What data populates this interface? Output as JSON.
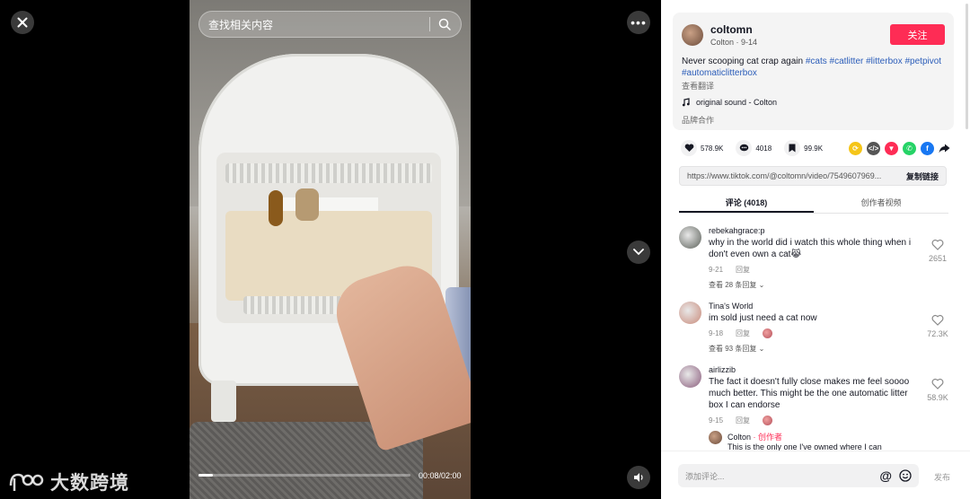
{
  "search": {
    "placeholder": "查找相关内容"
  },
  "player": {
    "progress_fraction": 0.066,
    "time_current": "00:08",
    "time_total": "02:00",
    "timecode": "00:08/02:00"
  },
  "watermark": {
    "text": "大数跨境"
  },
  "icons": {
    "close": "close-icon",
    "more": "more-icon",
    "down": "chevron-down-icon",
    "volume": "volume-icon",
    "search": "search-icon"
  },
  "author": {
    "username": "coltomn",
    "sub": "Colton · 9-14",
    "follow_label": "关注"
  },
  "caption": {
    "text": "Never scooping cat crap again ",
    "tags": [
      "#cats",
      "#catlitter",
      "#litterbox",
      "#petpivot",
      "#automaticlitterbox"
    ],
    "translate_label": "查看翻译"
  },
  "sound": {
    "label": "original sound - Colton"
  },
  "brand_label": "品牌合作",
  "stats": {
    "likes": "578.9K",
    "comments": "4018",
    "saves": "99.9K"
  },
  "share_colors": {
    "repost": "#f5c518",
    "embed": "#555555",
    "friends": "#fe2c55",
    "whatsapp": "#25d366",
    "facebook": "#1877f2"
  },
  "link": {
    "url": "https://www.tiktok.com/@coltomn/video/7549607969...",
    "copy_label": "复制链接"
  },
  "tabs": [
    {
      "label": "评论 (4018)",
      "active": true
    },
    {
      "label": "创作者视频",
      "active": false
    }
  ],
  "comments": [
    {
      "user": "rebekahgrace:p",
      "text": "why in the world did i watch this whole thing when i don't even own a cat😹",
      "date": "9-21",
      "reply_label": "回复",
      "likes": "2651",
      "replies_label": "查看 28 条回复",
      "avatar_color": "#5a5f58",
      "liked_by_author": false
    },
    {
      "user": "Tina's World",
      "text": "im sold just need a cat now",
      "date": "9-18",
      "reply_label": "回复",
      "likes": "72.3K",
      "replies_label": "查看 93 条回复",
      "avatar_color": "#c98a7a",
      "liked_by_author": true
    },
    {
      "user": "airlizzib",
      "text": "The fact it doesn't fully close makes me feel soooo much better. This might be the one automatic litter box I can endorse",
      "date": "9-15",
      "reply_label": "回复",
      "likes": "58.9K",
      "replies_label": "",
      "avatar_color": "#8a5c7c",
      "liked_by_author": true
    }
  ],
  "author_reply": {
    "user": "Colton",
    "badge": " · 创作者",
    "text": "This is the only one I've owned where I can"
  },
  "compose": {
    "placeholder": "添加评论...",
    "post_label": "发布"
  }
}
